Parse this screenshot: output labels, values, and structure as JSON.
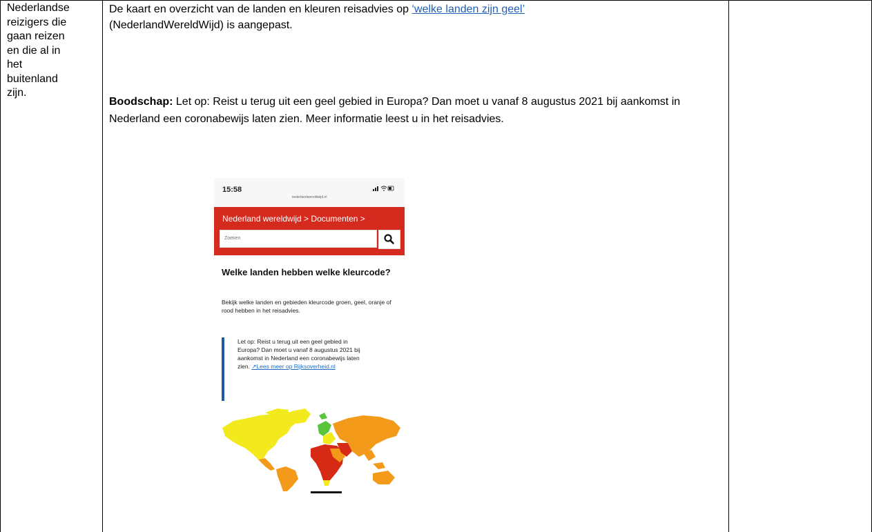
{
  "row": {
    "audience": [
      "Nederlandse",
      "reizigers die",
      "gaan reizen",
      "en die al in",
      "het",
      "buitenland",
      "zijn."
    ],
    "intro_before": "De kaart en overzicht van de landen en kleuren reisadvies op ",
    "intro_link": "‘welke landen zijn geel’",
    "intro_after": "(NederlandWereldWijd) is aangepast.",
    "message_label": "Boodschap:",
    "message_text": " Let op: Reist u terug uit een geel gebied in Europa? Dan moet u vanaf 8 augustus 2021 bij aankomst in Nederland een coronabewijs laten zien. Meer informatie leest u in het reisadvies."
  },
  "phone": {
    "time": "15:58",
    "signal": "",
    "url": "nederlandwereldwijd.nl",
    "breadcrumb": "Nederland wereldwijd > Documenten >",
    "search_placeholder": "Zoeken",
    "search_icon": "search-icon",
    "title": "Welke landen hebben welke kleurcode?",
    "body": "Bekijk welke landen en gebieden kleurcode groen, geel, oranje of rood hebben in het reisadvies.",
    "notice_text": "Let op: Reist u terug uit een geel gebied in Europa? Dan moet u vanaf 8 augustus 2021 bij aankomst in Nederland een coronabewijs laten zien. ",
    "notice_link": "↗Lees meer op Rijksoverheid.nl",
    "colors": {
      "header_red": "#d52b1e",
      "quote_blue": "#1d5c9e",
      "map_yellow": "#f2ea1c",
      "map_orange": "#f49a1a",
      "map_red": "#d62a14",
      "map_green": "#5ac43a"
    }
  }
}
